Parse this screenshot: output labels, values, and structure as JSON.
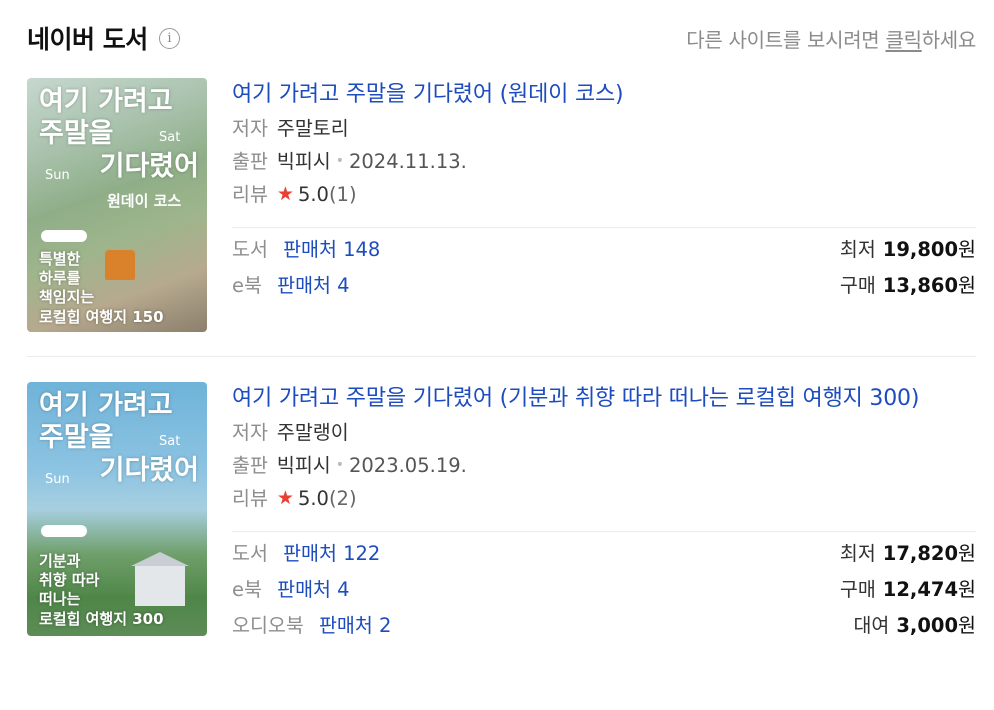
{
  "header": {
    "title": "네이버 도서",
    "info_icon": "info-icon",
    "other_site_prefix": "다른 사이트를 보시려면 ",
    "other_site_link": "클릭",
    "other_site_suffix": "하세요"
  },
  "books": [
    {
      "title": "여기 가려고 주말을 기다렸어 (원데이 코스)",
      "author_label": "저자",
      "author": "주말토리",
      "publisher_label": "출판",
      "publisher": "빅피시",
      "date": "2024.11.13.",
      "review_label": "리뷰",
      "rating": "5.0",
      "review_count": "(1)",
      "cover": {
        "line1": "여기 가려고",
        "line2": "주말을",
        "line3": "기다렸어",
        "sat": "Sat",
        "sun": "Sun",
        "sub": "원데이 코스",
        "tag1": "특별한",
        "tag2": "하루를",
        "tag3": "책임지는",
        "tag4": "로컬힙 여행지 150"
      },
      "prices": [
        {
          "kind": "도서",
          "seller": "판매처 148",
          "plabel": "최저",
          "price": "19,800",
          "unit": "원"
        },
        {
          "kind": "e북",
          "seller": "판매처 4",
          "plabel": "구매",
          "price": "13,860",
          "unit": "원"
        }
      ]
    },
    {
      "title": "여기 가려고 주말을 기다렸어 (기분과 취향 따라 떠나는 로컬힙 여행지 300)",
      "author_label": "저자",
      "author": "주말랭이",
      "publisher_label": "출판",
      "publisher": "빅피시",
      "date": "2023.05.19.",
      "review_label": "리뷰",
      "rating": "5.0",
      "review_count": "(2)",
      "cover": {
        "line1": "여기 가려고",
        "line2": "주말을",
        "line3": "기다렸어",
        "sat": "Sat",
        "sun": "Sun",
        "tag1": "기분과",
        "tag2": "취향 따라",
        "tag3": "떠나는",
        "tag4": "로컬힙 여행지 300"
      },
      "prices": [
        {
          "kind": "도서",
          "seller": "판매처 122",
          "plabel": "최저",
          "price": "17,820",
          "unit": "원"
        },
        {
          "kind": "e북",
          "seller": "판매처 4",
          "plabel": "구매",
          "price": "12,474",
          "unit": "원"
        },
        {
          "kind": "오디오북",
          "seller": "판매처 2",
          "plabel": "대여",
          "price": "3,000",
          "unit": "원"
        }
      ]
    }
  ],
  "colors": {
    "link_blue": "#1d4cbf",
    "star_red": "#e84034",
    "muted_gray": "#8e8e8e"
  }
}
